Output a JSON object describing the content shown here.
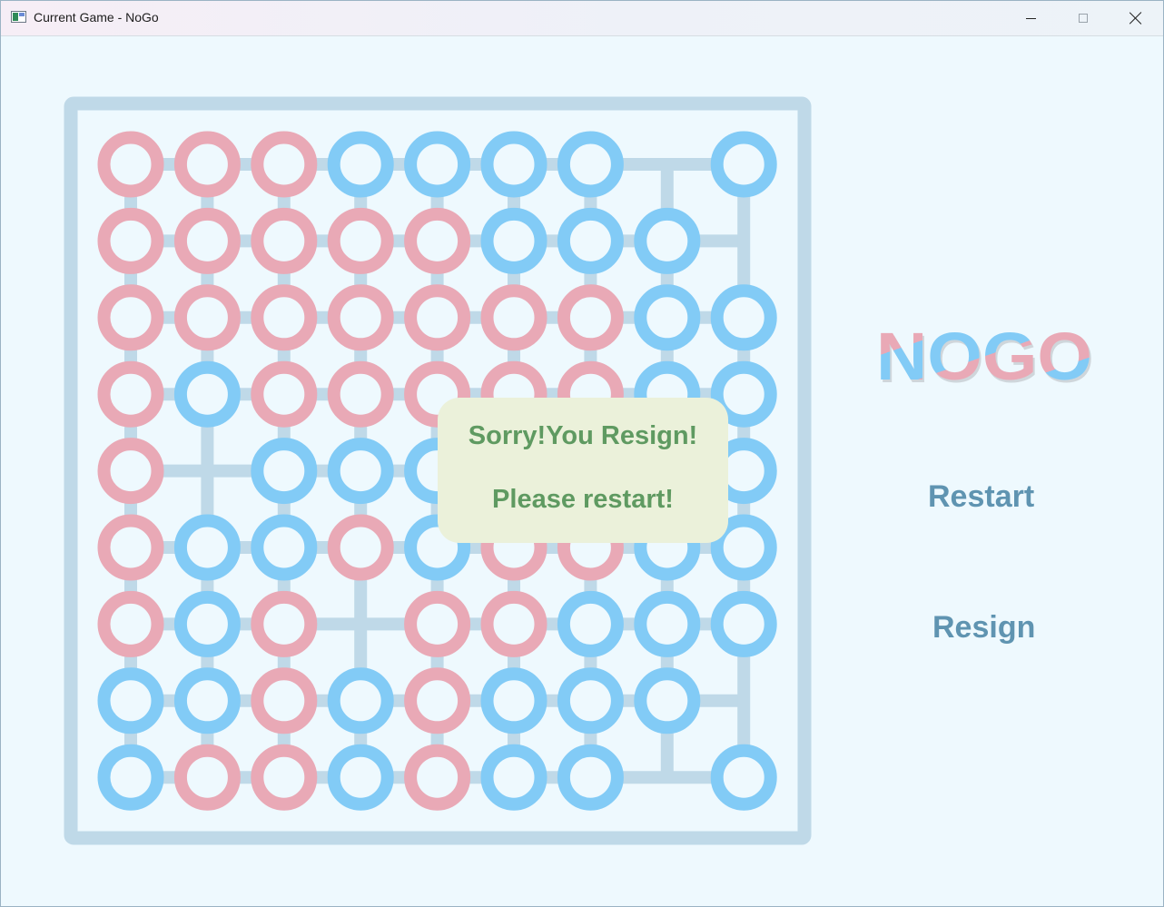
{
  "window": {
    "title": "Current Game - NoGo",
    "controls": {
      "minimize": "minimize",
      "maximize": "maximize",
      "close": "close"
    }
  },
  "colors": {
    "pink": "#e9a9b6",
    "blue": "#82cbf6",
    "grid": "#bfd9e8",
    "background": "#eef9fe",
    "dialog_bg": "#ebf1da",
    "dialog_text": "#5f9a61",
    "button_text": "#5f94b1"
  },
  "logo": {
    "text": "NOGO"
  },
  "buttons": {
    "restart": "Restart",
    "resign": "Resign"
  },
  "dialog": {
    "line1": "Sorry!You Resign!",
    "line2": "Please restart!"
  },
  "board": {
    "size": 9,
    "legend": "P = pink stone, B = blue stone, . = empty point",
    "rows": [
      "PPPBBBB.B",
      "PPPPPBBB.",
      "PPPPPPPBB",
      "PBPPPPPBB",
      "P.BBB...B",
      "PBBPBPPBB",
      "PBP.PPBBB",
      "BBPBPBBB.",
      "BPPBPBB.B"
    ]
  }
}
